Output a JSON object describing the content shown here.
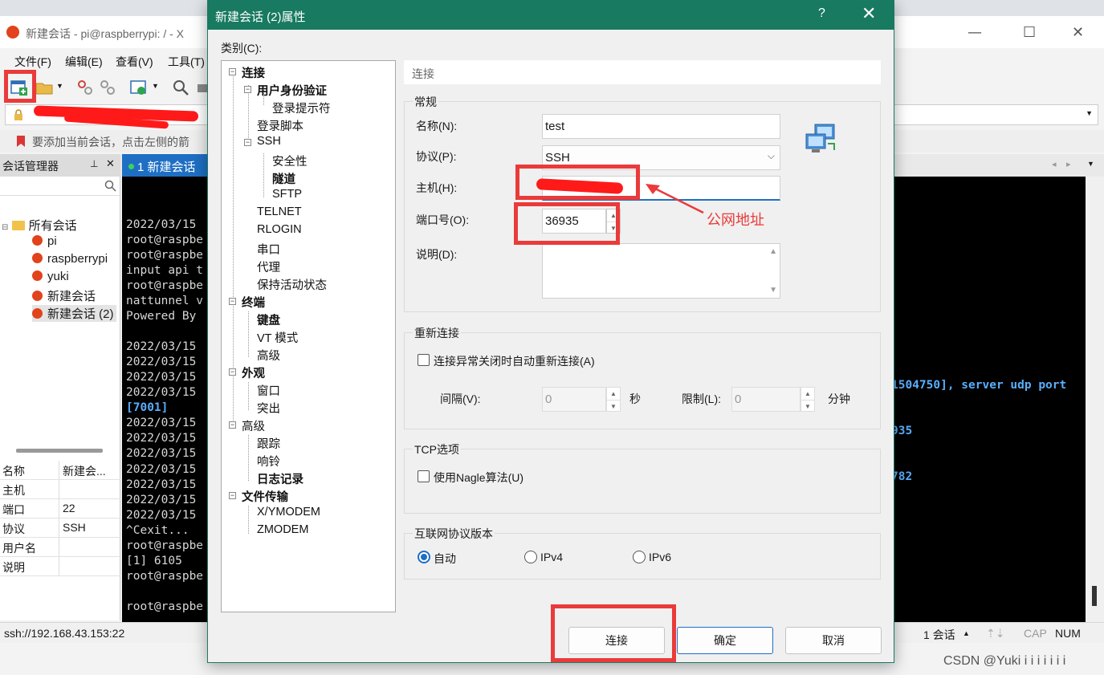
{
  "background_window": {
    "title": "新建会话 - pi@raspberrypi: / - X",
    "menu": [
      "文件(F)",
      "编辑(E)",
      "查看(V)",
      "工具(T)"
    ],
    "hint": "要添加当前会话，点击左侧的箭",
    "session_manager_label": "会话管理器",
    "active_tab": "1 新建会话",
    "tree": {
      "root": "所有会话",
      "sessions": [
        "pi",
        "raspberrypi",
        "yuki",
        "新建会话",
        "新建会话 (2)"
      ]
    },
    "properties": [
      {
        "key": "名称",
        "value": "新建会..."
      },
      {
        "key": "主机",
        "value": ""
      },
      {
        "key": "端口",
        "value": "22"
      },
      {
        "key": "协议",
        "value": "SSH"
      },
      {
        "key": "用户名",
        "value": ""
      },
      {
        "key": "说明",
        "value": ""
      }
    ],
    "terminal_lines": [
      {
        "text": "",
        "style": "normal"
      },
      {
        "text": "2022/03/15",
        "style": "normal"
      },
      {
        "text": "root@raspbe",
        "style": "normal"
      },
      {
        "text": "root@raspbe",
        "style": "normal"
      },
      {
        "text": "input api t",
        "style": "normal"
      },
      {
        "text": "root@raspbe",
        "style": "normal"
      },
      {
        "text": "nattunnel v",
        "style": "normal"
      },
      {
        "text": "Powered By",
        "style": "normal"
      },
      {
        "text": "",
        "style": "normal"
      },
      {
        "text": "2022/03/15",
        "style": "normal"
      },
      {
        "text": "2022/03/15",
        "style": "normal"
      },
      {
        "text": "2022/03/15",
        "style": "normal"
      },
      {
        "text": "2022/03/15",
        "style": "normal"
      },
      {
        "text": "[7001]",
        "style": "blue"
      },
      {
        "text": "2022/03/15",
        "style": "normal"
      },
      {
        "text": "2022/03/15",
        "style": "normal"
      },
      {
        "text": "2022/03/15",
        "style": "normal"
      },
      {
        "text": "2022/03/15",
        "style": "normal"
      },
      {
        "text": "2022/03/15",
        "style": "normal"
      },
      {
        "text": "2022/03/15",
        "style": "normal"
      },
      {
        "text": "2022/03/15",
        "style": "normal"
      },
      {
        "text": "^Cexit...",
        "style": "normal"
      },
      {
        "text": "root@raspbe",
        "style": "normal"
      },
      {
        "text": "[1] 6105",
        "style": "normal"
      },
      {
        "text": "root@raspbe",
        "style": "normal"
      },
      {
        "text": "",
        "style": "normal"
      },
      {
        "text": "root@raspbe",
        "style": "normal"
      }
    ],
    "terminal_right": [
      "1504750], server udp port",
      "935",
      "782"
    ],
    "status": {
      "connection": "ssh://192.168.43.153:22",
      "sessions": "1 会话",
      "cap": "CAP",
      "num": "NUM"
    }
  },
  "dialog": {
    "title": "新建会话 (2)属性",
    "help": "?",
    "category_label": "类别(C):",
    "section_title": "连接",
    "tree": {
      "connection": "连接",
      "user_auth": "用户身份验证",
      "login_prompt": "登录提示符",
      "login_script": "登录脚本",
      "ssh": "SSH",
      "security": "安全性",
      "tunnel": "隧道",
      "sftp": "SFTP",
      "telnet": "TELNET",
      "rlogin": "RLOGIN",
      "serial": "串口",
      "proxy": "代理",
      "keepalive": "保持活动状态",
      "terminal": "终端",
      "keyboard": "键盘",
      "vt_mode": "VT 模式",
      "terminal_advanced": "高级",
      "appearance": "外观",
      "window": "窗口",
      "highlight": "突出",
      "advanced": "高级",
      "trace": "跟踪",
      "bell": "响铃",
      "logging": "日志记录",
      "file_transfer": "文件传输",
      "xymodem": "X/YMODEM",
      "zmodem": "ZMODEM"
    },
    "general": {
      "title": "常规",
      "name_label": "名称(N):",
      "name_value": "test",
      "protocol_label": "协议(P):",
      "protocol_value": "SSH",
      "host_label": "主机(H):",
      "host_value": "",
      "port_label": "端口号(O):",
      "port_value": "36935",
      "desc_label": "说明(D):"
    },
    "reconnect": {
      "title": "重新连接",
      "checkbox_label": "连接异常关闭时自动重新连接(A)",
      "interval_label": "间隔(V):",
      "interval_value": "0",
      "sec_unit": "秒",
      "limit_label": "限制(L):",
      "limit_value": "0",
      "min_unit": "分钟"
    },
    "tcp": {
      "title": "TCP选项",
      "nagle_label": "使用Nagle算法(U)"
    },
    "ip_version": {
      "title": "互联网协议版本",
      "options": [
        "自动",
        "IPv4",
        "IPv6"
      ],
      "selected": "自动"
    },
    "buttons": {
      "connect": "连接",
      "ok": "确定",
      "cancel": "取消"
    }
  },
  "annotation": {
    "text": "公网地址",
    "color": "#ea3a3a"
  },
  "watermark": "CSDN @Yuki i i i i i i i"
}
